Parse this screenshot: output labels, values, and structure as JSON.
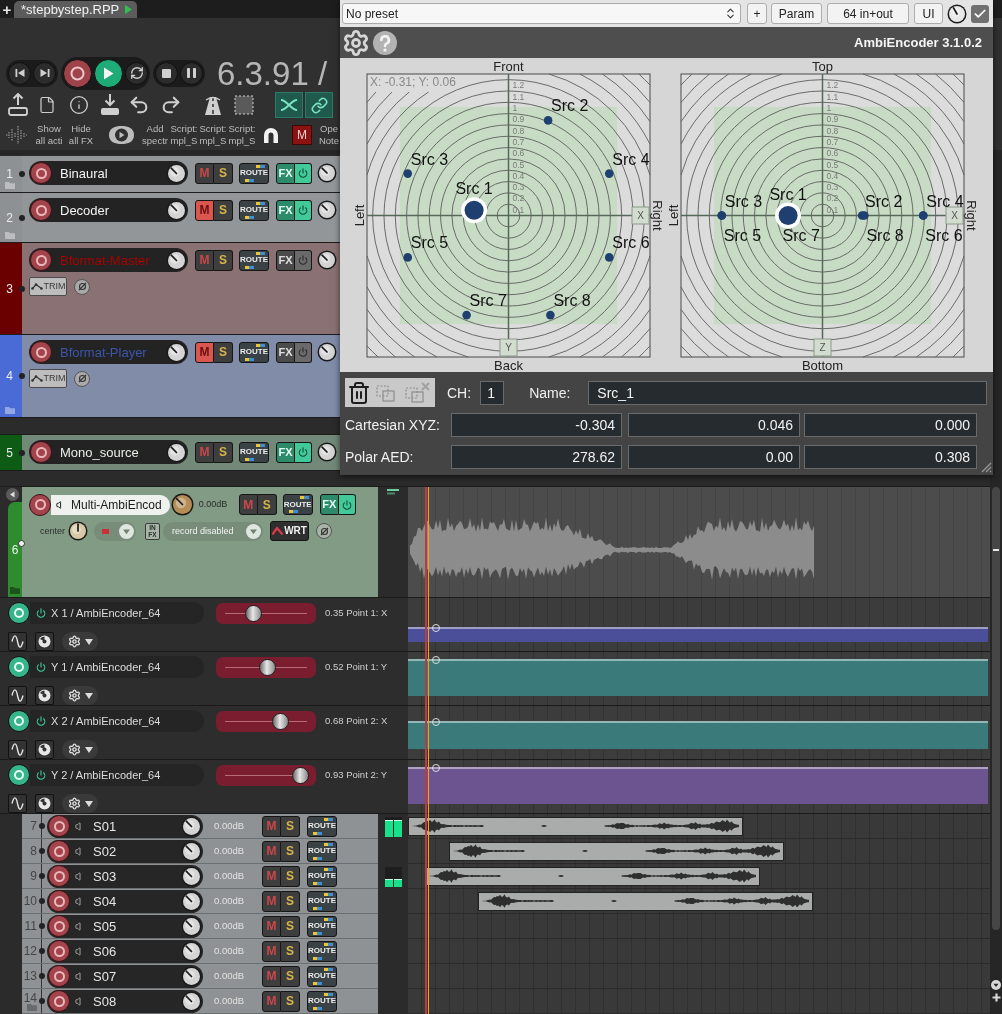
{
  "tabs": [
    {
      "label": "*stepbystep.RPP",
      "selected": true
    }
  ],
  "new_tab": "+",
  "transport": {
    "playing": true,
    "recording": false,
    "repeat": false,
    "time": "6.3.91 /"
  },
  "toolbar": {
    "toggles": [
      {
        "on": true
      },
      {
        "on": true
      }
    ],
    "buttons": [
      {
        "label": "Show all acti"
      },
      {
        "label": "Hide all FX"
      },
      {
        "label": "Add spectr"
      },
      {
        "label": "Script: mpl_S"
      },
      {
        "label": "Script: mpl_S"
      },
      {
        "label": "Script: mpl_S"
      },
      {
        "label": "Ope Note"
      }
    ],
    "mute_toggle": {
      "label": "M",
      "on": true
    }
  },
  "tracks": [
    {
      "kind": "standard",
      "number": "1",
      "name": "Binaural",
      "color": "#8d9193",
      "selected": false,
      "folder": true,
      "mute": {
        "label": "M",
        "on": false
      },
      "solo": {
        "label": "S",
        "on": false
      },
      "route": "ROUTE",
      "fx": {
        "label": "FX",
        "active": true
      }
    },
    {
      "kind": "standard",
      "number": "2",
      "name": "Decoder",
      "color": "#8d9193",
      "selected": false,
      "folder": true,
      "mute": {
        "label": "M",
        "on": true
      },
      "solo": {
        "label": "S",
        "on": false
      },
      "route": "ROUTE",
      "fx": {
        "label": "FX",
        "active": true
      }
    },
    {
      "kind": "standard",
      "number": "3",
      "name": "Bformat-Master",
      "color": "#6b0000",
      "selected": false,
      "folder": false,
      "mute": {
        "label": "M",
        "on": false
      },
      "solo": {
        "label": "S",
        "on": false
      },
      "route": "ROUTE",
      "fx": {
        "label": "FX",
        "active": false
      },
      "trim": "TRIM"
    },
    {
      "kind": "standard",
      "number": "4",
      "name": "Bformat-Player",
      "color": "#4a6bd6",
      "selected": false,
      "folder": true,
      "mute": {
        "label": "M",
        "on": true
      },
      "solo": {
        "label": "S",
        "on": false
      },
      "route": "ROUTE",
      "fx": {
        "label": "FX",
        "active": false
      },
      "trim": "TRIM"
    },
    {
      "kind": "standard",
      "number": "5",
      "name": "Mono_source",
      "color": "#0e5b15",
      "selected": false,
      "folder": false,
      "mute": {
        "label": "M",
        "on": false
      },
      "solo": {
        "label": "S",
        "on": false
      },
      "route": "ROUTE",
      "fx": {
        "label": "FX",
        "active": true
      }
    },
    {
      "kind": "expanded",
      "number": "6",
      "name": "Multi-AmbiEncod",
      "color": "#2e8b2e",
      "selected": true,
      "folder": true,
      "volume": "0.00dB",
      "mute": {
        "label": "M",
        "on": false
      },
      "solo": {
        "label": "S",
        "on": false
      },
      "route": "ROUTE",
      "fx": {
        "label": "FX",
        "active": true
      },
      "pan": "center",
      "input_fx": "IN FX",
      "record_mode": "record disabled",
      "automation": "WRT",
      "envelopes": [
        {
          "name": "X 1 / AmbiEncoder_64",
          "active": true,
          "level": 0.35,
          "reading": "0.35 Point 1: X",
          "color": "#4b4e98"
        },
        {
          "name": "Y 1 / AmbiEncoder_64",
          "active": true,
          "level": 0.52,
          "reading": "0.52 Point 1: Y",
          "color": "#3a7a7a"
        },
        {
          "name": "X 2 / AmbiEncoder_64",
          "active": true,
          "level": 0.68,
          "reading": "0.68 Point 2: X",
          "color": "#3a7a7a"
        },
        {
          "name": "Y 2 / AmbiEncoder_64",
          "active": true,
          "level": 0.93,
          "reading": "0.93 Point 2: Y",
          "color": "#6b5490"
        }
      ]
    },
    {
      "kind": "compact",
      "number": "7",
      "name": "S01",
      "selected": false,
      "folder": false,
      "volume": "0.00dB",
      "mute": {
        "label": "M",
        "on": false
      },
      "solo": {
        "label": "S",
        "on": false
      },
      "route": "ROUTE",
      "item": true,
      "meter": {
        "level": 0.85
      }
    },
    {
      "kind": "compact",
      "number": "8",
      "name": "S02",
      "selected": false,
      "folder": false,
      "volume": "0.00dB",
      "mute": {
        "label": "M",
        "on": false
      },
      "solo": {
        "label": "S",
        "on": false
      },
      "route": "ROUTE",
      "item": true
    },
    {
      "kind": "compact",
      "number": "9",
      "name": "S03",
      "selected": false,
      "folder": false,
      "volume": "0.00dB",
      "mute": {
        "label": "M",
        "on": false
      },
      "solo": {
        "label": "S",
        "on": false
      },
      "route": "ROUTE",
      "item": true,
      "meter": {
        "level": 0.4
      }
    },
    {
      "kind": "compact",
      "number": "10",
      "name": "S04",
      "selected": false,
      "folder": false,
      "volume": "0.00dB",
      "mute": {
        "label": "M",
        "on": false
      },
      "solo": {
        "label": "S",
        "on": false
      },
      "route": "ROUTE",
      "item": true
    },
    {
      "kind": "compact",
      "number": "11",
      "name": "S05",
      "selected": false,
      "folder": false,
      "volume": "0.00dB",
      "mute": {
        "label": "M",
        "on": false
      },
      "solo": {
        "label": "S",
        "on": false
      },
      "route": "ROUTE",
      "item": false
    },
    {
      "kind": "compact",
      "number": "12",
      "name": "S06",
      "selected": false,
      "folder": false,
      "volume": "0.00dB",
      "mute": {
        "label": "M",
        "on": false
      },
      "solo": {
        "label": "S",
        "on": false
      },
      "route": "ROUTE",
      "item": false
    },
    {
      "kind": "compact",
      "number": "13",
      "name": "S07",
      "selected": false,
      "folder": false,
      "volume": "0.00dB",
      "mute": {
        "label": "M",
        "on": false
      },
      "solo": {
        "label": "S",
        "on": false
      },
      "route": "ROUTE",
      "item": false
    },
    {
      "kind": "compact",
      "number": "14",
      "name": "S08",
      "selected": false,
      "folder": true,
      "volume": "0.00dB",
      "mute": {
        "label": "M",
        "on": false
      },
      "solo": {
        "label": "S",
        "on": false
      },
      "route": "ROUTE",
      "item": false
    }
  ],
  "plugin": {
    "preset": "No preset",
    "add_preset": "+",
    "buttons": [
      "Param",
      "64 in+out",
      "UI"
    ],
    "enabled": true,
    "title": "AmbiEncoder 3.1.0.2",
    "plots": [
      {
        "top": "Front",
        "bottom": "Back",
        "left": "Left",
        "right": "Right",
        "h_handle": "X",
        "v_handle": "Y",
        "readout": "X: -0.31; Y: 0.06",
        "ring_labels": [
          "1.2",
          "1.1",
          "1",
          "0.9",
          "0.8",
          "0.7",
          "0.6",
          "0.5",
          "0.4",
          "0.3",
          "0.2",
          "0.1"
        ],
        "sources": [
          {
            "label": "Src 2",
            "selected": false
          },
          {
            "label": "Src 3",
            "selected": false
          },
          {
            "label": "Src 4",
            "selected": false
          },
          {
            "label": "Src 1",
            "selected": true
          },
          {
            "label": "Src 5",
            "selected": false
          },
          {
            "label": "Src 6",
            "selected": false
          },
          {
            "label": "Src 7",
            "selected": false
          },
          {
            "label": "Src 8",
            "selected": false
          }
        ]
      },
      {
        "top": "Top",
        "bottom": "Bottom",
        "left": "Left",
        "right": "Right",
        "h_handle": "X",
        "v_handle": "Z",
        "ring_labels": [
          "1.2",
          "1.1",
          "1",
          "0.9",
          "0.8",
          "0.7",
          "0.6",
          "0.5",
          "0.4",
          "0.3",
          "0.2",
          "0.1"
        ],
        "sources": [
          {
            "label": "Src 3",
            "selected": false
          },
          {
            "label": "Src 1",
            "selected": true
          },
          {
            "label": "Src 2",
            "selected": false
          },
          {
            "label": "Src 4",
            "selected": false
          },
          {
            "label": "Src 5",
            "selected": false
          },
          {
            "label": "Src 7",
            "selected": false
          },
          {
            "label": "Src 8",
            "selected": false
          },
          {
            "label": "Src 6",
            "selected": false
          }
        ]
      }
    ],
    "channel_label": "CH:",
    "channel": "1",
    "name_label": "Name:",
    "name": "Src_1",
    "coordinates": [
      {
        "label": "Cartesian XYZ:",
        "values": [
          "-0.304",
          "0.046",
          "0.000"
        ]
      },
      {
        "label": "Polar AED:",
        "values": [
          "278.62",
          "0.00",
          "0.308"
        ]
      }
    ]
  }
}
